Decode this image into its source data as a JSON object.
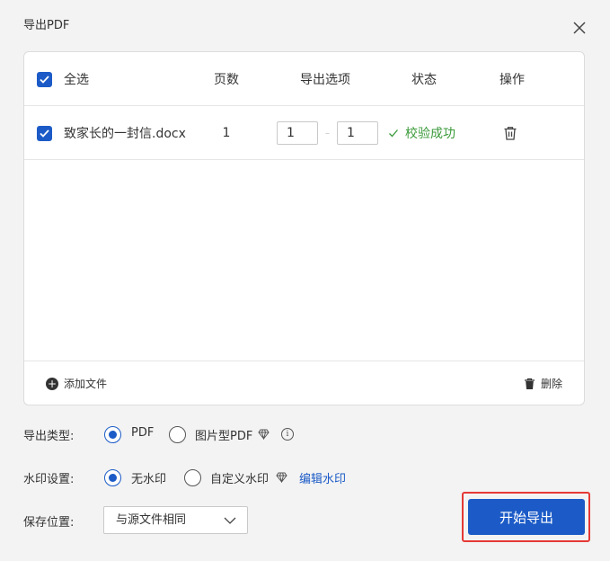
{
  "dialog": {
    "title": "导出PDF"
  },
  "table": {
    "headers": {
      "select_all": "全选",
      "pages": "页数",
      "export_options": "导出选项",
      "status": "状态",
      "actions": "操作"
    },
    "rows": [
      {
        "filename": "致家长的一封信.docx",
        "pages": "1",
        "range_from": "1",
        "range_to": "1",
        "status": "校验成功"
      }
    ]
  },
  "footer": {
    "add_file": "添加文件",
    "delete": "删除"
  },
  "options": {
    "export_type": {
      "label": "导出类型:",
      "choices": [
        "PDF",
        "图片型PDF"
      ],
      "selected": "PDF"
    },
    "watermark": {
      "label": "水印设置:",
      "choices": [
        "无水印",
        "自定义水印"
      ],
      "selected": "无水印",
      "edit_link": "编辑水印"
    },
    "save_location": {
      "label": "保存位置:",
      "value": "与源文件相同"
    }
  },
  "actions": {
    "start_export": "开始导出"
  },
  "colors": {
    "accent": "#1c5bc7",
    "success": "#3a9a3a",
    "highlight": "#e53935"
  }
}
